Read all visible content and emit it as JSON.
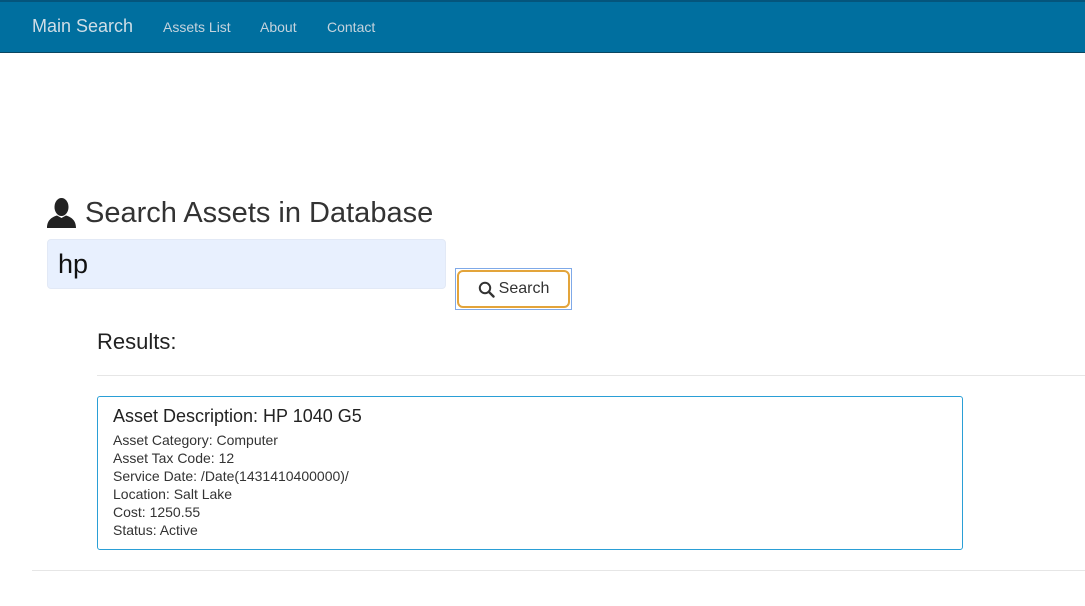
{
  "navbar": {
    "brand": "Main Search",
    "links": [
      "Assets List",
      "About",
      "Contact"
    ]
  },
  "page": {
    "heading": "Search Assets in Database",
    "heading_icon": "user-icon"
  },
  "search": {
    "value": "hp",
    "button_label": "Search",
    "button_icon": "search-icon"
  },
  "results": {
    "title": "Results:",
    "items": [
      {
        "description_label": "Asset Description: HP 1040 G5",
        "category_line": "Asset Category: Computer",
        "tax_code_line": "Asset Tax Code: 12",
        "service_date_line": "Service Date: /Date(1431410400000)/",
        "location_line": "Location: Salt Lake",
        "cost_line": "Cost: 1250.55",
        "status_line": "Status: Active"
      }
    ]
  },
  "colors": {
    "navbar_bg": "#006f9f",
    "input_bg": "#e8f0fe",
    "button_focus_border": "#e3a43a",
    "card_border": "#2a9fd6"
  }
}
